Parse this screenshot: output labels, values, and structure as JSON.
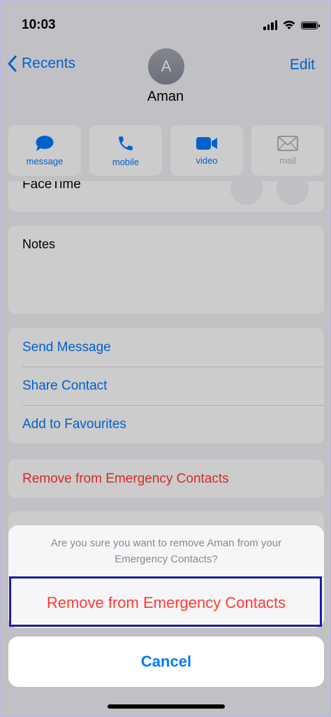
{
  "status_bar": {
    "time": "10:03"
  },
  "nav": {
    "back_label": "Recents",
    "edit_label": "Edit"
  },
  "contact": {
    "initial": "A",
    "name": "Aman"
  },
  "actions": [
    {
      "label": "message",
      "icon": "message-bubble-icon"
    },
    {
      "label": "mobile",
      "icon": "phone-icon"
    },
    {
      "label": "video",
      "icon": "video-camera-icon"
    },
    {
      "label": "mail",
      "icon": "envelope-icon",
      "disabled": true
    }
  ],
  "facetime": {
    "label": "FaceTime"
  },
  "notes": {
    "label": "Notes"
  },
  "options": {
    "send_message": "Send Message",
    "share_contact": "Share Contact",
    "add_favourites": "Add to Favourites"
  },
  "emergency": {
    "remove_label": "Remove from Emergency Contacts"
  },
  "action_sheet": {
    "message_line1": "Are you sure you want to remove Aman from your",
    "message_line2": "Emergency Contacts?",
    "confirm_label": "Remove from Emergency Contacts",
    "cancel_label": "Cancel"
  },
  "colors": {
    "accent": "#007aff",
    "destructive": "#ff3b30",
    "highlight_border": "#1c1ca9"
  }
}
